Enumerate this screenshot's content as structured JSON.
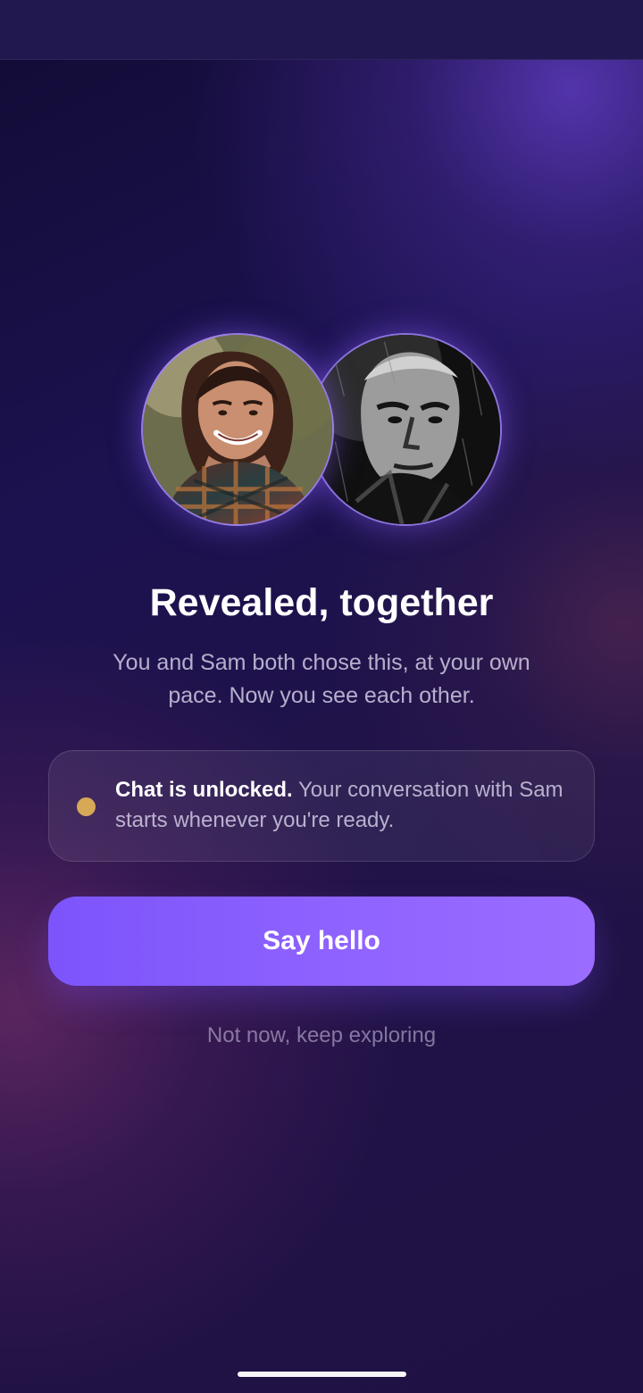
{
  "reveal": {
    "headline": "Revealed, together",
    "subtitle": "You and Sam both chose this, at your own pace. Now you see each other.",
    "notice_bold": "Chat is unlocked.",
    "notice_rest": " Your conversation with Sam starts whenever you're ready.",
    "primary_button": "Say hello",
    "secondary_link": "Not now, keep exploring"
  },
  "colors": {
    "accent": "#8b5cf6",
    "notice_dot": "#d7a957",
    "background": "#1c1250"
  },
  "icons": {
    "notice": "status-dot-icon"
  }
}
